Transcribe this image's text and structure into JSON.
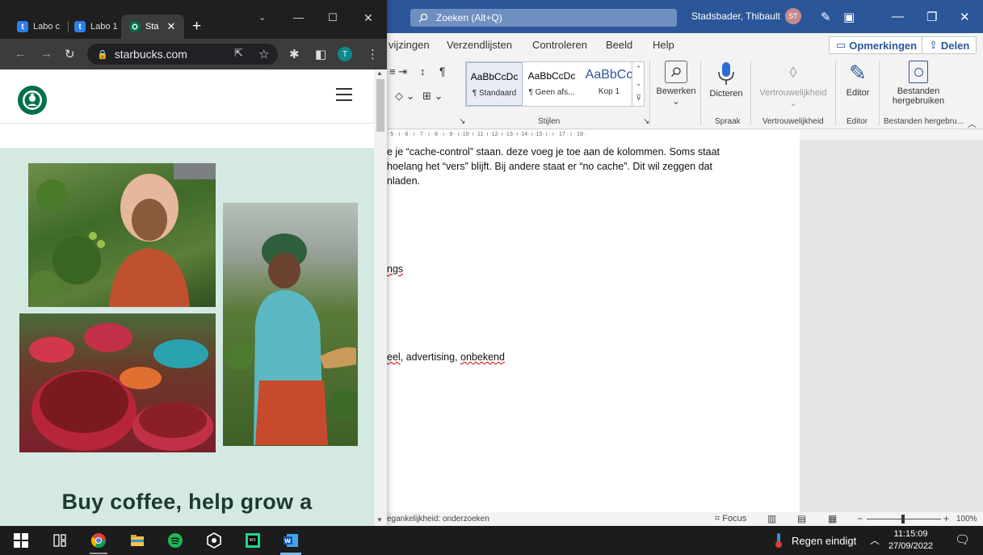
{
  "word": {
    "search_placeholder": "Zoeken (Alt+Q)",
    "user_name": "Stadsbader, Thibault",
    "user_initials": "ST",
    "tabs": [
      "vijzingen",
      "Verzendlijsten",
      "Controleren",
      "Beeld",
      "Help"
    ],
    "comments_label": "Opmerkingen",
    "share_label": "Delen",
    "styles": [
      {
        "sample": "AaBbCcDc",
        "name": "¶ Standaard"
      },
      {
        "sample": "AaBbCcDc",
        "name": "¶ Geen afs..."
      },
      {
        "sample": "AaBbCc",
        "name": "Kop 1"
      }
    ],
    "group_labels": {
      "styles": "Stijlen",
      "voice": "Spraak",
      "sensitivity": "Vertrouwelijkheid",
      "editor": "Editor",
      "reuse": "Bestanden hergebru..."
    },
    "buttons": {
      "edit": "Bewerken",
      "dictate": "Dicteren",
      "sensitivity": "Vertrouwelijkheid",
      "editor": "Editor",
      "reuse_line1": "Bestanden",
      "reuse_line2": "hergebruiken"
    },
    "ruler_text": "· 5 · ı · 6 · ı · 7 · ı · 8 · ı · 9 · ı ·10· ı ·11· ı ·12· ı ·13· ı ·14· ı ·15· ı · ı · 17 · ı · 18 ·",
    "doc_lines": {
      "line1": "e je “cache-control” staan. deze voeg je toe aan de kolommen. Soms staat",
      "line2": " hoelang het “vers” blijft. Bij andere staat er “no cache”. Dit wil zeggen dat",
      "line3": "nladen.",
      "line4": "ngs",
      "line5_a": "eel",
      "line5_b": ", advertising, ",
      "line5_c": "onbekend"
    },
    "status": {
      "accessibility": "egankelijkheid: onderzoeken",
      "focus": "Focus",
      "zoom": "100%"
    }
  },
  "chrome": {
    "tabs": [
      {
        "label": "Labo c",
        "favicon": "t"
      },
      {
        "label": "Labo 1",
        "favicon": "t"
      },
      {
        "label": "Sta",
        "favicon": "starbucks"
      }
    ],
    "url": "starbucks.com",
    "profile_initial": "T"
  },
  "starbucks": {
    "headline": "Buy coffee, help grow a",
    "brand_color": "#00704a"
  },
  "taskbar": {
    "weather": "Regen eindigt",
    "time": "11:15:09",
    "date": "27/09/2022"
  }
}
